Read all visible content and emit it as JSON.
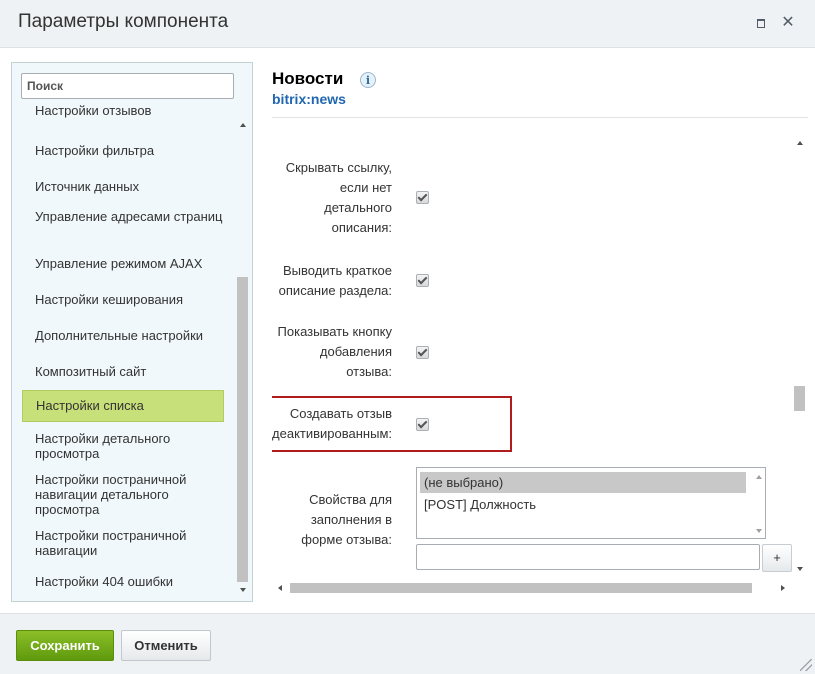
{
  "window": {
    "title": "Параметры компонента",
    "maximize_icon": "maximize-icon",
    "close_icon": "close-icon",
    "close_glyph": "✕"
  },
  "sidebar": {
    "search_placeholder": "Поиск",
    "items": [
      {
        "label": "Настройки отзывов",
        "active": false
      },
      {
        "label": "Настройки фильтра",
        "active": false
      },
      {
        "label": "Источник данных",
        "active": false
      },
      {
        "label": "Управление адресами страниц",
        "active": false
      },
      {
        "label": "Управление режимом AJAX",
        "active": false
      },
      {
        "label": "Настройки кеширования",
        "active": false
      },
      {
        "label": "Дополнительные настройки",
        "active": false
      },
      {
        "label": "Композитный сайт",
        "active": false
      },
      {
        "label": "Настройки списка",
        "active": true
      },
      {
        "label": "Настройки детального просмотра",
        "active": false
      },
      {
        "label": "Настройки постраничной навигации детального просмотра",
        "active": false
      },
      {
        "label": "Настройки постраничной навигации",
        "active": false
      },
      {
        "label": "Настройки 404 ошибки",
        "active": false
      }
    ]
  },
  "component": {
    "name": "Новости",
    "code": "bitrix:news",
    "info_glyph": "i"
  },
  "settings": {
    "hide_link_label_lines": [
      "Скрывать ссылку,",
      "если нет",
      "детального",
      "описания:"
    ],
    "hide_link_checked": true,
    "show_section_desc_lines": [
      "Выводить краткое",
      "описание раздела:"
    ],
    "show_section_desc_checked": true,
    "show_add_review_lines": [
      "Показывать кнопку",
      "добавления",
      "отзыва:"
    ],
    "show_add_review_checked": true,
    "create_inactive_lines": [
      "Создавать отзыв",
      "деактивированным:"
    ],
    "create_inactive_checked": true,
    "review_props_lines": [
      "Свойства для",
      "заполнения в",
      "форме отзыва:"
    ],
    "review_props_options": [
      {
        "label": "(не выбрано)",
        "selected": true
      },
      {
        "label": "[POST] Должность",
        "selected": false
      }
    ],
    "review_props_input_value": "",
    "add_button_label": "+"
  },
  "footer": {
    "save_label": "Сохранить",
    "cancel_label": "Отменить"
  },
  "colors": {
    "active_item": "#c8e07a",
    "save_button": "#6fa71a",
    "highlight_border": "#b01c1c",
    "link_blue": "#2067b0"
  }
}
